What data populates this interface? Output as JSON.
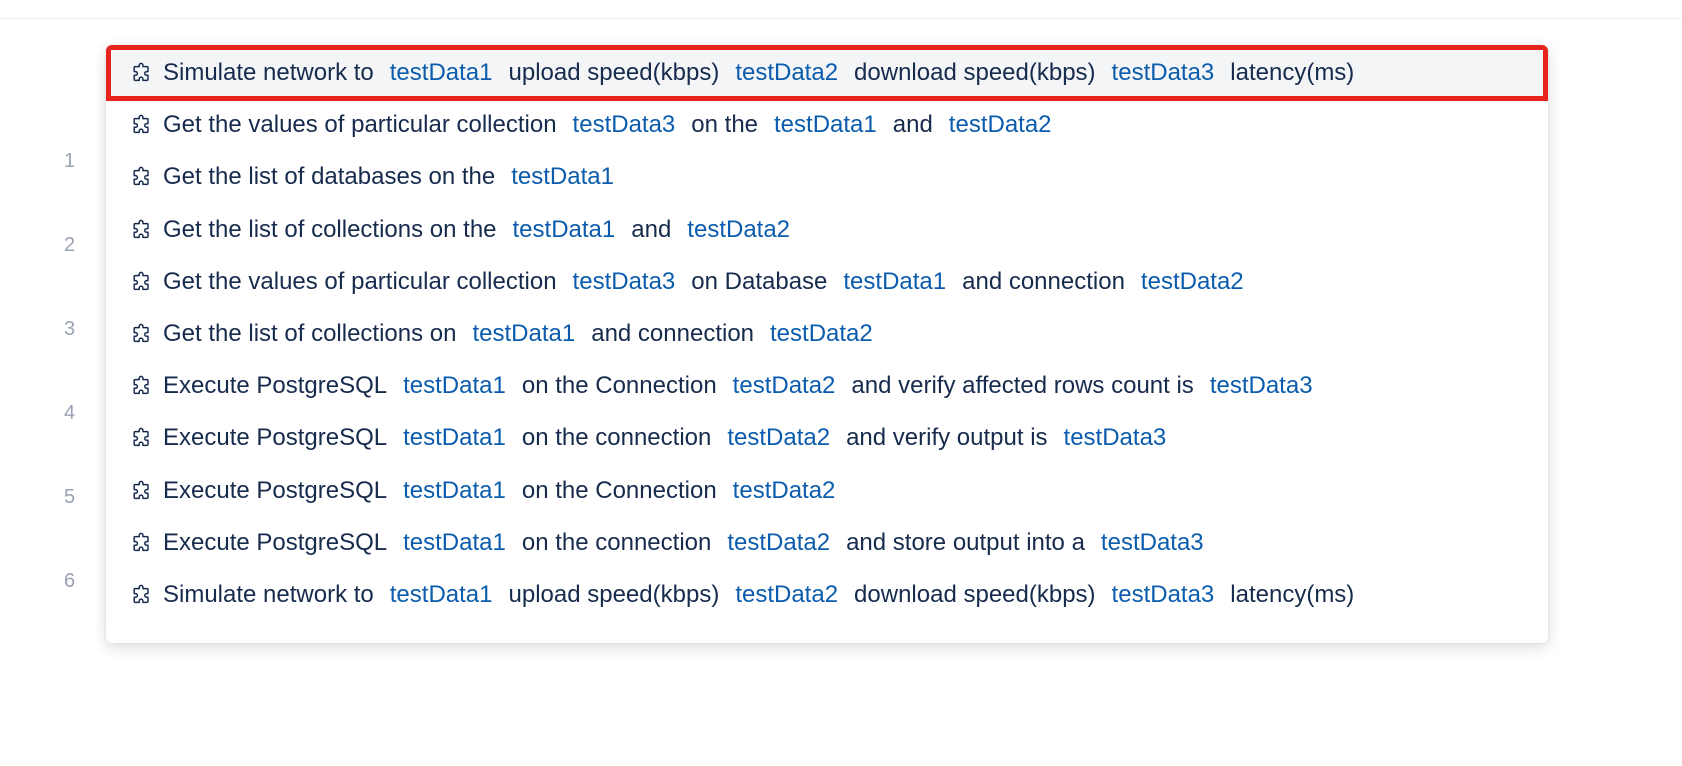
{
  "line_numbers": [
    "1",
    "2",
    "3",
    "4",
    "5",
    "6"
  ],
  "colors": {
    "text": "#172b4d",
    "param": "#0b5cad",
    "selected_border": "#e8231c",
    "selected_bg": "#f4f5f7",
    "line_number": "#9aa3b5"
  },
  "suggestions": [
    {
      "icon": "puzzle-icon",
      "selected": true,
      "segments": [
        {
          "type": "text",
          "value": "Simulate network to"
        },
        {
          "type": "param",
          "value": "testData1"
        },
        {
          "type": "text",
          "value": "upload speed(kbps)"
        },
        {
          "type": "param",
          "value": "testData2"
        },
        {
          "type": "text",
          "value": "download speed(kbps)"
        },
        {
          "type": "param",
          "value": "testData3"
        },
        {
          "type": "text",
          "value": "latency(ms)"
        }
      ]
    },
    {
      "icon": "puzzle-icon",
      "segments": [
        {
          "type": "text",
          "value": "Get the values of particular collection"
        },
        {
          "type": "param",
          "value": "testData3"
        },
        {
          "type": "text",
          "value": "on the"
        },
        {
          "type": "param",
          "value": "testData1"
        },
        {
          "type": "text",
          "value": "and"
        },
        {
          "type": "param",
          "value": "testData2"
        }
      ]
    },
    {
      "icon": "puzzle-icon",
      "segments": [
        {
          "type": "text",
          "value": "Get the list of databases on the"
        },
        {
          "type": "param",
          "value": "testData1"
        }
      ]
    },
    {
      "icon": "puzzle-icon",
      "segments": [
        {
          "type": "text",
          "value": "Get the list of collections on the"
        },
        {
          "type": "param",
          "value": "testData1"
        },
        {
          "type": "text",
          "value": "and"
        },
        {
          "type": "param",
          "value": "testData2"
        }
      ]
    },
    {
      "icon": "puzzle-icon",
      "segments": [
        {
          "type": "text",
          "value": "Get the values of particular collection"
        },
        {
          "type": "param",
          "value": "testData3"
        },
        {
          "type": "text",
          "value": "on Database"
        },
        {
          "type": "param",
          "value": "testData1"
        },
        {
          "type": "text",
          "value": "and connection"
        },
        {
          "type": "param",
          "value": "testData2"
        }
      ]
    },
    {
      "icon": "puzzle-icon",
      "segments": [
        {
          "type": "text",
          "value": "Get the list of collections on"
        },
        {
          "type": "param",
          "value": "testData1"
        },
        {
          "type": "text",
          "value": "and connection"
        },
        {
          "type": "param",
          "value": "testData2"
        }
      ]
    },
    {
      "icon": "puzzle-icon",
      "segments": [
        {
          "type": "text",
          "value": "Execute PostgreSQL"
        },
        {
          "type": "param",
          "value": "testData1"
        },
        {
          "type": "text",
          "value": "on the Connection"
        },
        {
          "type": "param",
          "value": "testData2"
        },
        {
          "type": "text",
          "value": "and verify affected rows count is"
        },
        {
          "type": "param",
          "value": "testData3"
        }
      ]
    },
    {
      "icon": "puzzle-icon",
      "segments": [
        {
          "type": "text",
          "value": "Execute PostgreSQL"
        },
        {
          "type": "param",
          "value": "testData1"
        },
        {
          "type": "text",
          "value": "on the connection"
        },
        {
          "type": "param",
          "value": "testData2"
        },
        {
          "type": "text",
          "value": "and verify output is"
        },
        {
          "type": "param",
          "value": "testData3"
        }
      ]
    },
    {
      "icon": "puzzle-icon",
      "segments": [
        {
          "type": "text",
          "value": "Execute PostgreSQL"
        },
        {
          "type": "param",
          "value": "testData1"
        },
        {
          "type": "text",
          "value": "on the Connection"
        },
        {
          "type": "param",
          "value": "testData2"
        }
      ]
    },
    {
      "icon": "puzzle-icon",
      "segments": [
        {
          "type": "text",
          "value": "Execute PostgreSQL"
        },
        {
          "type": "param",
          "value": "testData1"
        },
        {
          "type": "text",
          "value": "on the connection"
        },
        {
          "type": "param",
          "value": "testData2"
        },
        {
          "type": "text",
          "value": "and store output into a"
        },
        {
          "type": "param",
          "value": "testData3"
        }
      ]
    },
    {
      "icon": "puzzle-icon",
      "segments": [
        {
          "type": "text",
          "value": "Simulate network to"
        },
        {
          "type": "param",
          "value": "testData1"
        },
        {
          "type": "text",
          "value": "upload speed(kbps)"
        },
        {
          "type": "param",
          "value": "testData2"
        },
        {
          "type": "text",
          "value": "download speed(kbps)"
        },
        {
          "type": "param",
          "value": "testData3"
        },
        {
          "type": "text",
          "value": "latency(ms)"
        }
      ]
    }
  ]
}
